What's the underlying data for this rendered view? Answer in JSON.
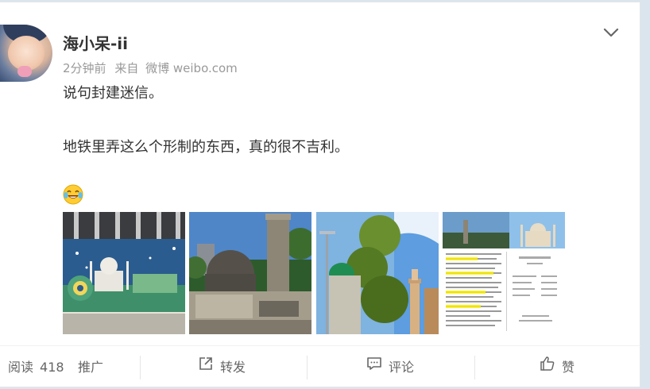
{
  "post": {
    "username": "海小呆-ii",
    "time": "2分钟前",
    "source_prefix": "来自",
    "source": "微博 weibo.com",
    "lines": [
      "说句封建迷信。",
      "地铁里弄这么个形制的东西，真的很不吉利。"
    ],
    "emoji": "laughing-tears-icon"
  },
  "images": [
    {
      "name": "subway-mural-taj-mahal-peacock"
    },
    {
      "name": "stone-dome-and-pillar-monument"
    },
    {
      "name": "mosque-dome-and-minaret"
    },
    {
      "name": "document-and-taj-mahal-collage"
    }
  ],
  "footer": {
    "read_label": "阅读",
    "read_count": "418",
    "promote": "推广",
    "repost": "转发",
    "comment": "评论",
    "like": "赞"
  },
  "colors": {
    "highlight": "#fff200",
    "footer_text": "#666666",
    "meta": "#999999"
  }
}
